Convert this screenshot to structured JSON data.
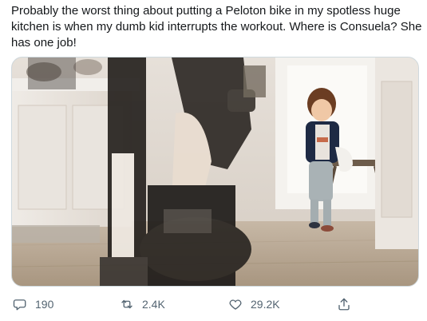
{
  "tweet": {
    "text": "Probably the worst thing about putting a Peloton bike in my spotless huge kitchen is when my dumb kid interrupts the workout. Where is Consuela? She has one job!"
  },
  "media": {
    "kind": "video-still"
  },
  "actions": {
    "reply_count": "190",
    "retweet_count": "2.4K",
    "like_count": "29.2K"
  },
  "icons": {
    "reply": "reply-icon",
    "retweet": "retweet-icon",
    "like": "heart-icon",
    "share": "share-icon"
  },
  "colors": {
    "text": "#14171a",
    "action_gray": "#536471",
    "media_border": "#cfd9de"
  }
}
